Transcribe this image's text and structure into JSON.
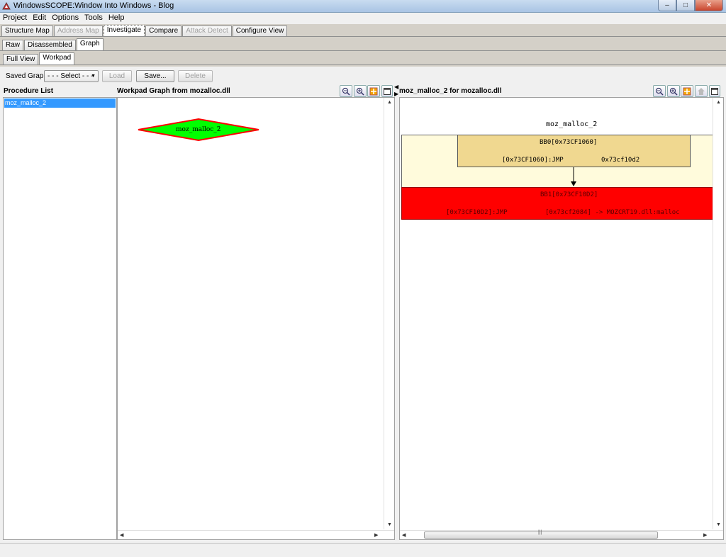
{
  "window": {
    "title": "WindowsSCOPE:Window Into Windows - Blog",
    "minimize": "–",
    "maximize": "□",
    "close": "✕"
  },
  "menu": [
    "Project",
    "Edit",
    "Options",
    "Tools",
    "Help"
  ],
  "main_tabs": [
    {
      "label": "Structure Map",
      "state": "normal"
    },
    {
      "label": "Address Map",
      "state": "disabled"
    },
    {
      "label": "Investigate",
      "state": "active"
    },
    {
      "label": "Compare",
      "state": "normal"
    },
    {
      "label": "Attack Detect",
      "state": "disabled"
    },
    {
      "label": "Configure View",
      "state": "normal"
    }
  ],
  "sub_tabs": [
    {
      "label": "Raw",
      "state": "normal"
    },
    {
      "label": "Disassembled",
      "state": "normal"
    },
    {
      "label": "Graph",
      "state": "active"
    }
  ],
  "view_tabs": [
    {
      "label": "Full View",
      "state": "normal"
    },
    {
      "label": "Workpad",
      "state": "active"
    }
  ],
  "toolbar": {
    "saved_graph_label": "Saved Graph",
    "select_value": "- - - Select - - -",
    "load_label": "Load",
    "save_label": "Save...",
    "delete_label": "Delete"
  },
  "procedure_list": {
    "header": "Procedure List",
    "items": [
      "moz_malloc_2"
    ]
  },
  "workpad": {
    "header": "Workpad Graph from mozalloc.dll",
    "node_label": "moz_malloc_2",
    "node_fill": "#00ff00",
    "node_border": "#ff0000"
  },
  "detail": {
    "header": "moz_malloc_2 for mozalloc.dll",
    "graph_title": "moz_malloc_2",
    "blocks": [
      {
        "name": "BB0[0x73CF1060]",
        "instr": "[0x73CF1060]:JMP",
        "target": "0x73cf10d2",
        "fill": "#f0d890"
      },
      {
        "name": "BB1[0x73CF10D2]",
        "instr": "[0x73CF10D2]:JMP",
        "target": "[0x73cf2084] -> MOZCRT19.dll:malloc",
        "fill": "#ff0000"
      }
    ],
    "background_band": "#fffbdc"
  },
  "icons": {
    "zoom_out": "zoom-out-icon",
    "zoom_in": "zoom-in-icon",
    "fit": "fit-graph-icon",
    "maximize": "maximize-pane-icon",
    "home": "home-icon"
  }
}
